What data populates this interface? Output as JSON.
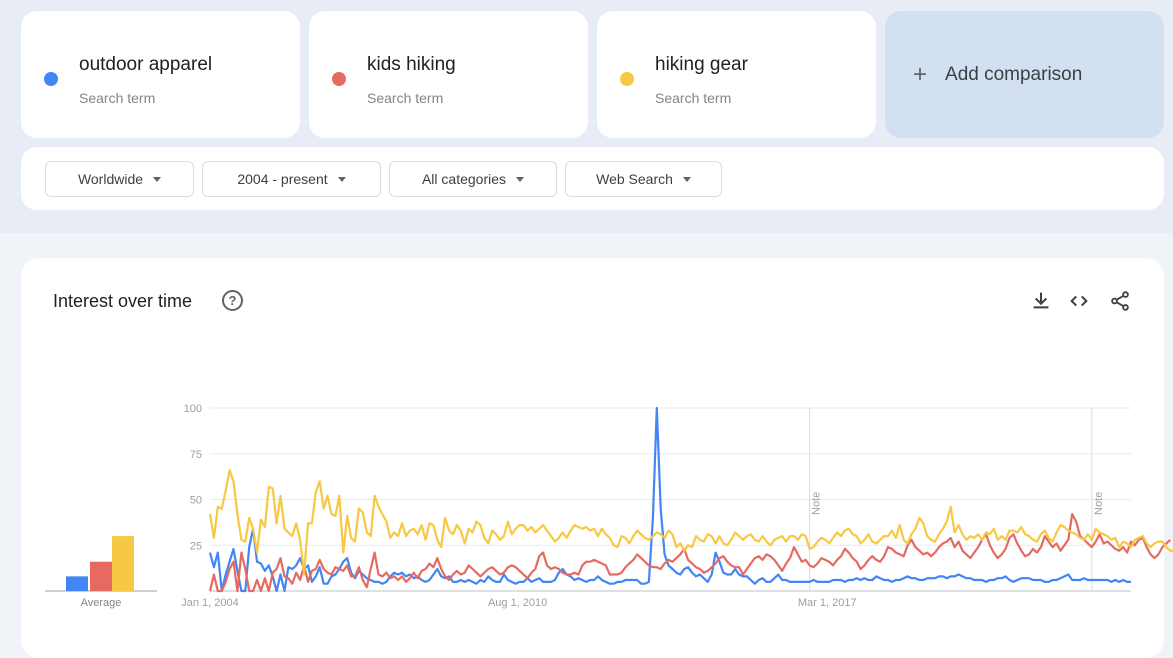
{
  "terms": [
    {
      "name": "outdoor apparel",
      "subtitle": "Search term",
      "color": "#4285f4"
    },
    {
      "name": "kids hiking",
      "subtitle": "Search term",
      "color": "#e66a62"
    },
    {
      "name": "hiking gear",
      "subtitle": "Search term",
      "color": "#f7c843"
    }
  ],
  "add_comparison": {
    "icon": "plus-icon",
    "label": "Add comparison"
  },
  "filters": [
    {
      "label": "Worldwide"
    },
    {
      "label": "2004 - present"
    },
    {
      "label": "All categories"
    },
    {
      "label": "Web Search"
    }
  ],
  "panel": {
    "title": "Interest over time",
    "help_icon": "?",
    "actions": [
      "download-icon",
      "embed-icon",
      "share-icon"
    ]
  },
  "chart_data": {
    "type": "line",
    "title": "Interest over time",
    "xlabel": "",
    "ylabel": "",
    "ylim": [
      0,
      100
    ],
    "yticks": [
      25,
      50,
      75,
      100
    ],
    "xticks": [
      "Jan 1, 2004",
      "Aug 1, 2010",
      "Mar 1, 2017"
    ],
    "x_start": "2004-01",
    "x_step": "month",
    "grid": true,
    "notes": [
      {
        "date": "2016-01",
        "label": "Note"
      },
      {
        "date": "2022-01",
        "label": "Note"
      }
    ],
    "average": {
      "label": "Average",
      "values": [
        8,
        16,
        30
      ]
    },
    "series": [
      {
        "name": "outdoor apparel",
        "color": "#4285f4",
        "values": [
          21,
          13,
          21,
          0,
          9,
          16,
          23,
          11,
          0,
          0,
          24,
          34,
          16,
          15,
          11,
          14,
          8,
          0,
          9,
          0,
          13,
          12,
          14,
          18,
          12,
          14,
          5,
          8,
          13,
          4,
          4,
          8,
          9,
          12,
          16,
          18,
          10,
          7,
          11,
          9,
          7,
          6,
          5,
          5,
          4,
          5,
          8,
          10,
          9,
          10,
          8,
          9,
          7,
          8,
          6,
          5,
          6,
          9,
          12,
          8,
          7,
          8,
          5,
          5,
          6,
          5,
          6,
          5,
          4,
          6,
          5,
          8,
          6,
          5,
          5,
          9,
          6,
          5,
          4,
          5,
          5,
          7,
          5,
          6,
          7,
          5,
          5,
          5,
          6,
          10,
          12,
          9,
          8,
          6,
          7,
          6,
          5,
          6,
          6,
          8,
          6,
          5,
          4,
          4,
          5,
          5,
          6,
          6,
          6,
          6,
          4,
          4,
          5,
          40,
          100,
          45,
          20,
          14,
          12,
          10,
          9,
          12,
          13,
          10,
          8,
          9,
          7,
          5,
          9,
          21,
          16,
          10,
          9,
          9,
          12,
          9,
          8,
          8,
          6,
          4,
          6,
          7,
          5,
          5,
          7,
          9,
          6,
          6,
          5,
          5,
          5,
          5,
          5,
          5,
          6,
          5,
          5,
          5,
          5,
          6,
          6,
          6,
          5,
          6,
          6,
          7,
          6,
          7,
          6,
          6,
          8,
          7,
          6,
          6,
          5,
          6,
          6,
          7,
          8,
          7,
          7,
          6,
          6,
          7,
          7,
          7,
          8,
          8,
          7,
          8,
          8,
          9,
          8,
          7,
          7,
          6,
          6,
          6,
          5,
          6,
          6,
          7,
          7,
          8,
          6,
          5,
          6,
          7,
          7,
          7,
          6,
          6,
          6,
          5,
          5,
          6,
          6,
          7,
          8,
          9,
          6,
          6,
          6,
          7,
          6,
          6,
          6,
          6,
          6,
          6,
          5,
          6,
          5,
          6,
          5,
          5
        ]
      },
      {
        "name": "kids hiking",
        "color": "#e66a62",
        "values": [
          0,
          9,
          0,
          0,
          5,
          12,
          16,
          0,
          21,
          12,
          0,
          0,
          6,
          0,
          7,
          0,
          10,
          12,
          18,
          8,
          7,
          4,
          10,
          6,
          14,
          5,
          11,
          12,
          17,
          12,
          10,
          9,
          13,
          12,
          11,
          14,
          8,
          8,
          13,
          6,
          2,
          12,
          21,
          9,
          8,
          10,
          7,
          8,
          6,
          8,
          5,
          7,
          10,
          7,
          11,
          12,
          15,
          13,
          18,
          12,
          8,
          6,
          9,
          11,
          9,
          10,
          14,
          12,
          10,
          8,
          10,
          12,
          13,
          11,
          9,
          10,
          13,
          14,
          13,
          11,
          9,
          7,
          10,
          12,
          19,
          21,
          14,
          12,
          13,
          12,
          10,
          9,
          9,
          10,
          9,
          14,
          16,
          16,
          17,
          16,
          15,
          14,
          9,
          9,
          9,
          10,
          13,
          15,
          17,
          20,
          18,
          16,
          14,
          13,
          13,
          12,
          15,
          17,
          16,
          18,
          20,
          23,
          17,
          15,
          13,
          12,
          10,
          11,
          13,
          15,
          18,
          19,
          16,
          14,
          13,
          13,
          9,
          12,
          15,
          18,
          19,
          17,
          20,
          19,
          17,
          14,
          11,
          15,
          18,
          24,
          20,
          16,
          17,
          14,
          13,
          15,
          18,
          17,
          16,
          14,
          17,
          19,
          23,
          21,
          18,
          16,
          12,
          14,
          17,
          19,
          17,
          16,
          19,
          24,
          23,
          21,
          20,
          19,
          25,
          28,
          24,
          22,
          20,
          21,
          19,
          21,
          24,
          26,
          27,
          29,
          24,
          27,
          22,
          20,
          18,
          21,
          24,
          28,
          31,
          25,
          21,
          18,
          20,
          23,
          29,
          31,
          26,
          22,
          19,
          20,
          23,
          21,
          24,
          30,
          27,
          24,
          26,
          22,
          25,
          28,
          42,
          38,
          30,
          28,
          26,
          24,
          27,
          31,
          26,
          27,
          25,
          23,
          22,
          24,
          21,
          27,
          25,
          28,
          29,
          24,
          20,
          18,
          20,
          24,
          26,
          28
        ]
      },
      {
        "name": "hiking gear",
        "color": "#f7c843",
        "values": [
          42,
          29,
          46,
          45,
          55,
          66,
          60,
          42,
          28,
          27,
          40,
          34,
          21,
          39,
          35,
          57,
          56,
          37,
          52,
          34,
          32,
          30,
          37,
          28,
          9,
          37,
          37,
          54,
          60,
          45,
          52,
          42,
          41,
          52,
          21,
          41,
          29,
          27,
          45,
          43,
          32,
          30,
          52,
          46,
          42,
          38,
          29,
          32,
          30,
          37,
          30,
          33,
          34,
          31,
          36,
          28,
          37,
          36,
          28,
          24,
          40,
          33,
          31,
          36,
          33,
          26,
          34,
          32,
          38,
          36,
          29,
          26,
          33,
          31,
          28,
          30,
          38,
          31,
          34,
          36,
          36,
          33,
          35,
          32,
          34,
          36,
          33,
          30,
          27,
          29,
          32,
          29,
          33,
          36,
          35,
          34,
          35,
          33,
          34,
          30,
          34,
          31,
          29,
          25,
          24,
          30,
          29,
          26,
          30,
          33,
          31,
          29,
          28,
          30,
          32,
          31,
          29,
          33,
          31,
          24,
          26,
          22,
          25,
          24,
          30,
          28,
          27,
          31,
          30,
          26,
          30,
          26,
          25,
          28,
          32,
          30,
          28,
          30,
          31,
          28,
          27,
          30,
          27,
          25,
          28,
          29,
          30,
          27,
          30,
          30,
          28,
          31,
          30,
          23,
          24,
          27,
          29,
          28,
          26,
          29,
          32,
          30,
          33,
          34,
          31,
          30,
          26,
          28,
          31,
          27,
          26,
          28,
          30,
          30,
          33,
          29,
          36,
          28,
          26,
          31,
          34,
          40,
          37,
          30,
          28,
          27,
          31,
          34,
          38,
          46,
          32,
          36,
          31,
          28,
          30,
          29,
          31,
          28,
          32,
          31,
          34,
          28,
          30,
          28,
          33,
          33,
          32,
          35,
          31,
          30,
          28,
          27,
          31,
          33,
          29,
          27,
          32,
          36,
          35,
          33,
          32,
          31,
          29,
          28,
          31,
          28,
          34,
          32,
          31,
          30,
          28,
          29,
          24,
          27,
          26,
          24,
          28,
          29,
          30,
          26,
          24,
          26,
          27,
          27,
          24,
          22,
          22,
          27,
          23,
          24,
          24,
          24,
          22,
          22,
          23,
          25
        ]
      }
    ]
  }
}
